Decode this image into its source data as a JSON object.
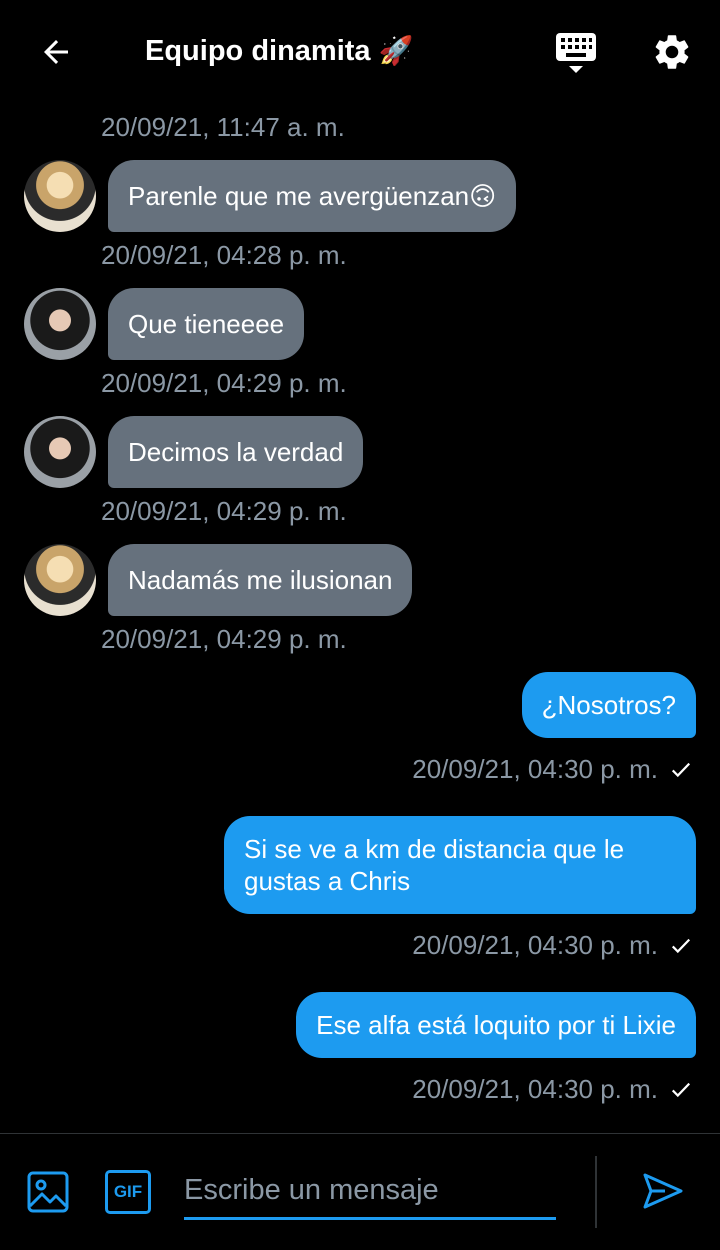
{
  "header": {
    "title": "Equipo dinamita",
    "title_emoji": "🚀"
  },
  "messages": [
    {
      "type": "timestamp",
      "text": "20/09/21, 11:47 a. m."
    },
    {
      "type": "in",
      "text": "Parenle que me avergüenzan🙃",
      "timestamp": "20/09/21, 04:28 p. m."
    },
    {
      "type": "in",
      "text": "Que tieneeee",
      "timestamp": "20/09/21, 04:29 p. m."
    },
    {
      "type": "in",
      "text": "Decimos la verdad",
      "timestamp": "20/09/21, 04:29 p. m."
    },
    {
      "type": "in",
      "text": "Nadamás me ilusionan",
      "timestamp": "20/09/21, 04:29 p. m."
    },
    {
      "type": "out",
      "text": "¿Nosotros?",
      "timestamp": "20/09/21, 04:30 p. m."
    },
    {
      "type": "out",
      "text": "Si se ve a km de distancia que le gustas a Chris",
      "timestamp": "20/09/21, 04:30 p. m."
    },
    {
      "type": "out",
      "text": "Ese alfa está loquito por ti Lixie",
      "timestamp": "20/09/21, 04:30 p. m."
    }
  ],
  "composer": {
    "gif_label": "GIF",
    "placeholder": "Escribe un mensaje"
  },
  "colors": {
    "accent": "#1d9bf0",
    "incoming_bubble": "#66717d",
    "timestamp": "#8b98a5",
    "background": "#000000"
  }
}
